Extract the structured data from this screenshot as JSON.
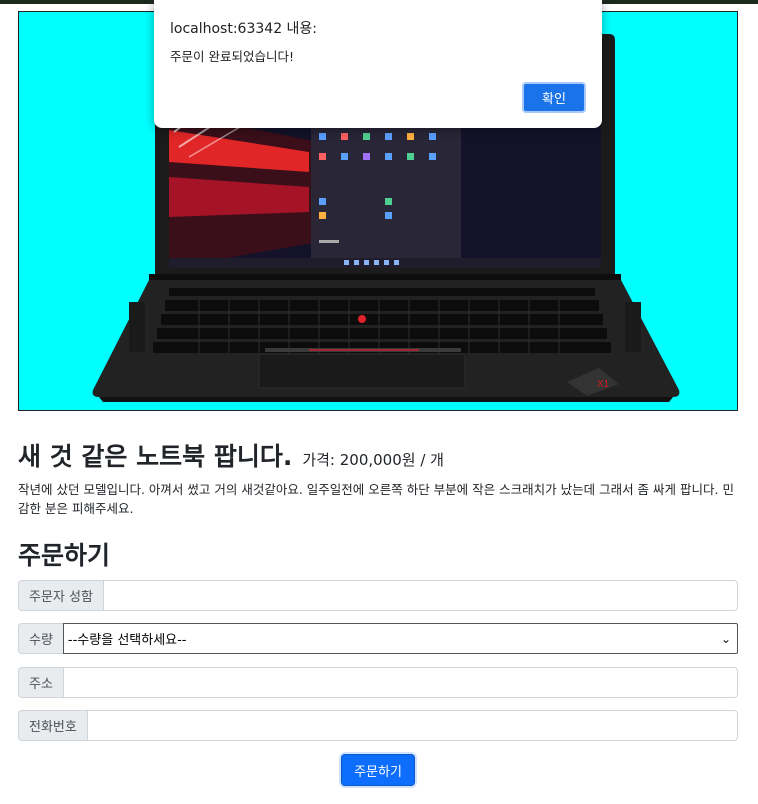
{
  "dialog": {
    "title": "localhost:63342 내용:",
    "message": "주문이 완료되었습니다!",
    "ok_label": "확인"
  },
  "product": {
    "title": "새 것 같은 노트북 팝니다.",
    "price": "가격: 200,000원 / 개",
    "description": "작년에 샀던 모델입니다. 아껴서 썼고 거의 새것같아요. 일주일전에 오른쪽 하단 부분에 작은 스크래치가 났는데 그래서 좀 싸게 팝니다. 민감한 분은 피해주세요.",
    "image_background": "#00ffff"
  },
  "order": {
    "heading": "주문하기",
    "name_label": "주문자 성함",
    "name_value": "",
    "quantity_label": "수량",
    "quantity_selected": "--수량을 선택하세요--",
    "address_label": "주소",
    "address_value": "",
    "phone_label": "전화번호",
    "phone_value": "",
    "submit_label": "주문하기"
  },
  "colors": {
    "primary": "#0d6efd",
    "dialog_button": "#1a73e8"
  }
}
